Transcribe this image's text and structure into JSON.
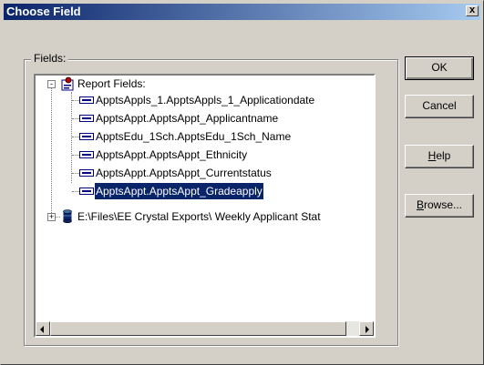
{
  "window": {
    "title": "Choose Field",
    "close_glyph": "x"
  },
  "group": {
    "label": "Fields:"
  },
  "tree": {
    "root": {
      "label": "Report Fields:",
      "expander": "-",
      "icon": "report-icon",
      "children": [
        "ApptsAppls_1.ApptsAppls_1_Applicationdate",
        "ApptsAppt.ApptsAppt_Applicantname",
        "ApptsEdu_1Sch.ApptsEdu_1Sch_Name",
        "ApptsAppt.ApptsAppt_Ethnicity",
        "ApptsAppt.ApptsAppt_Currentstatus",
        "ApptsAppt.ApptsAppt_Gradeapply"
      ],
      "selected_child": "ApptsAppt.ApptsAppt_Gradeapply"
    },
    "database": {
      "label": "E:\\Files\\EE Crystal Exports\\ Weekly Applicant Stat",
      "expander": "+",
      "icon": "database-icon"
    }
  },
  "buttons": {
    "ok": "OK",
    "cancel": "Cancel",
    "help_first": "H",
    "help_rest": "elp",
    "browse_first": "B",
    "browse_rest": "rowse..."
  },
  "colors": {
    "face": "#d4d0c8",
    "title_start": "#0a246a",
    "title_end": "#a6caf0",
    "selection": "#0a246a"
  }
}
